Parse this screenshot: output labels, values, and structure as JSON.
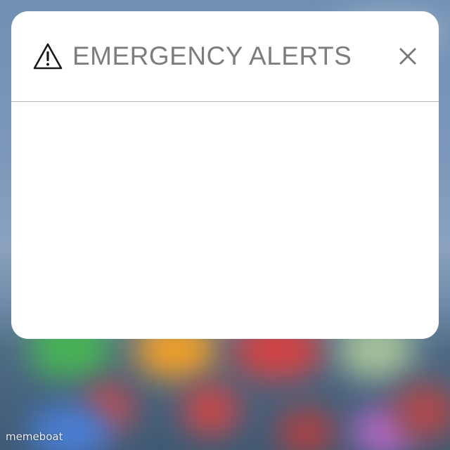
{
  "alert": {
    "title": "EMERGENCY ALERTS",
    "icon": "warning-triangle-icon",
    "close_icon": "close-icon",
    "title_color": "#7d7d7d",
    "background": "#ffffff"
  },
  "watermark": {
    "text": "memeboat"
  }
}
